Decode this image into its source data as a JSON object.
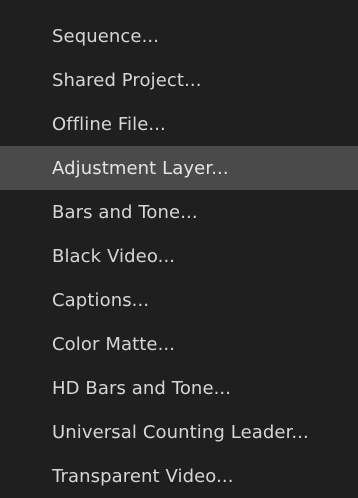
{
  "menu": {
    "highlighted_index": 3,
    "items": [
      {
        "label": "Sequence..."
      },
      {
        "label": "Shared Project..."
      },
      {
        "label": "Offline File..."
      },
      {
        "label": "Adjustment Layer..."
      },
      {
        "label": "Bars and Tone..."
      },
      {
        "label": "Black Video..."
      },
      {
        "label": "Captions..."
      },
      {
        "label": "Color Matte..."
      },
      {
        "label": "HD Bars and Tone..."
      },
      {
        "label": "Universal Counting Leader..."
      },
      {
        "label": "Transparent Video..."
      }
    ]
  },
  "colors": {
    "menu_background": "#1f1f1f",
    "highlight_background": "#4a4a4a",
    "text": "#d6d6d6"
  }
}
